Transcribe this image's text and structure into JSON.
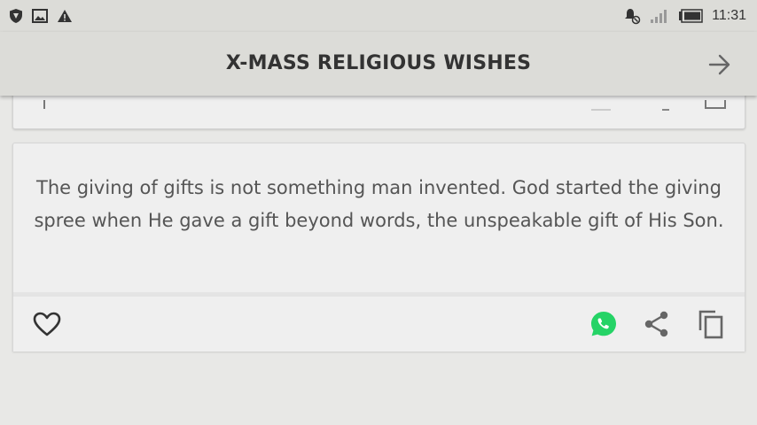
{
  "status_bar": {
    "time": "11:31",
    "left_icons": [
      "shield-icon",
      "image-icon",
      "warning-icon"
    ],
    "right_icons": [
      "notification-muted-icon",
      "signal-icon",
      "battery-icon"
    ]
  },
  "app_bar": {
    "title": "X-MASS RELIGIOUS WISHES",
    "forward_icon": "arrow-forward-icon"
  },
  "quote_card": {
    "text": "The giving of gifts is not something man invented. God started the giving spree when He gave a gift beyond words, the unspeakable gift of His Son.",
    "actions": [
      "heart-icon",
      "whatsapp-icon",
      "share-icon",
      "copy-icon"
    ]
  },
  "colors": {
    "bar_background": "#dcdcd8",
    "card_background": "#efefef",
    "whatsapp_green": "#25d366",
    "text": "#555555"
  }
}
